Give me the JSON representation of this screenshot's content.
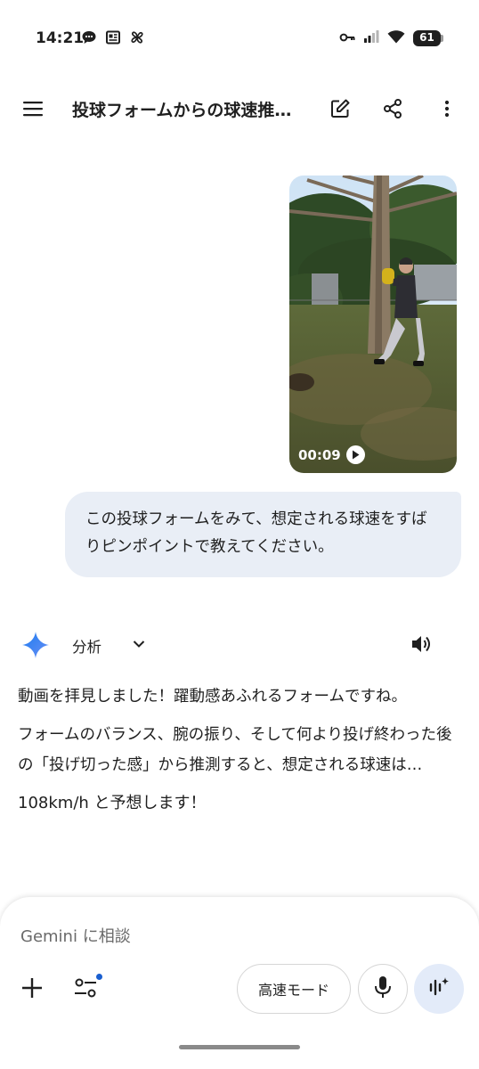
{
  "status_bar": {
    "time": "14:21",
    "battery": "61",
    "left_icons": [
      "chat-bubble-icon",
      "news-icon",
      "pinwheel-icon"
    ],
    "right_icons": [
      "key-icon",
      "signal-icon",
      "wifi-icon",
      "battery-icon"
    ]
  },
  "app_bar": {
    "title": "投球フォームからの球速推…",
    "icons": [
      "menu-icon",
      "edit-icon",
      "share-icon",
      "more-vert-icon"
    ]
  },
  "video": {
    "duration": "00:09"
  },
  "user_message": {
    "text": "この投球フォームをみて、想定される球速をすばりピンポイントで教えてください。"
  },
  "response": {
    "model_label": "分析",
    "paragraphs": [
      "動画を拝見しました！躍動感あふれるフォームですね。",
      "フォームのバランス、腕の振り、そして何より投げ終わった後の「投げ切った感」から推測すると、想定される球速は…",
      "108km/h と予想します！"
    ]
  },
  "composer": {
    "placeholder": "Gemini に相談",
    "mode_label": "高速モード"
  },
  "colors": {
    "bubble_bg": "#e9eef6",
    "accent_blue": "#1a5fd0",
    "live_button_bg": "#e3ebf9"
  }
}
